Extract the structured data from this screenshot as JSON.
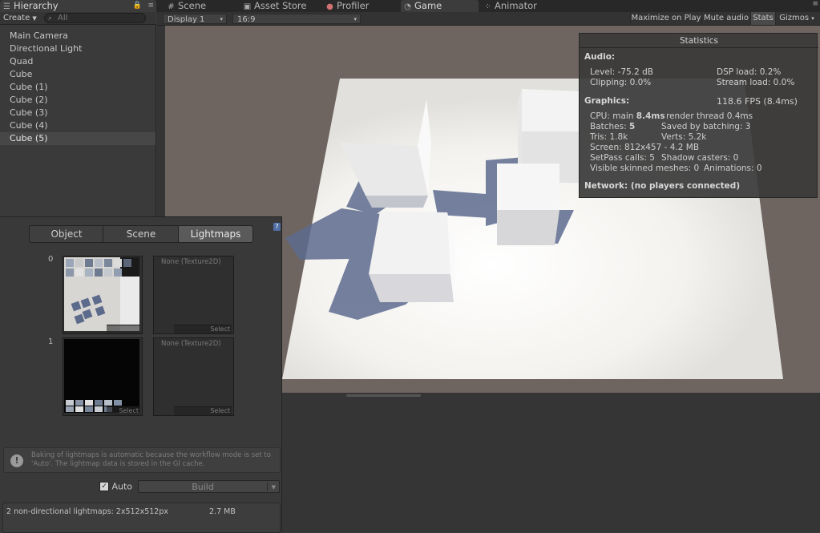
{
  "tabs": {
    "hierarchy": "Hierarchy",
    "scene": "Scene",
    "asset_store": "Asset Store",
    "profiler": "Profiler",
    "game": "Game",
    "animator": "Animator"
  },
  "hierarchy": {
    "create_label": "Create",
    "search_placeholder": "All",
    "items": [
      {
        "label": "Main Camera"
      },
      {
        "label": "Directional Light"
      },
      {
        "label": "Quad"
      },
      {
        "label": "Cube"
      },
      {
        "label": "Cube (1)"
      },
      {
        "label": "Cube (2)"
      },
      {
        "label": "Cube (3)"
      },
      {
        "label": "Cube (4)"
      },
      {
        "label": "Cube (5)"
      }
    ],
    "selected_index": 8
  },
  "game_toolbar": {
    "display": "Display 1",
    "aspect": "16:9",
    "maximize": "Maximize on Play",
    "mute": "Mute audio",
    "stats": "Stats",
    "gizmos": "Gizmos"
  },
  "lighting": {
    "tabs": [
      "Object",
      "Scene",
      "Lightmaps"
    ],
    "active_tab": "Lightmaps",
    "lightmaps": [
      {
        "index": "0",
        "none_label": "None (Texture2D)",
        "select": "Select"
      },
      {
        "index": "1",
        "none_label": "None (Texture2D)",
        "select": "Select"
      }
    ],
    "info": "Baking of lightmaps is automatic because the workflow mode is set to 'Auto'. The lightmap data is stored in the GI cache.",
    "auto_label": "Auto",
    "build_label": "Build",
    "summary": "2 non-directional lightmaps: 2x512x512px",
    "size": "2.7 MB"
  },
  "stats": {
    "title": "Statistics",
    "audio_header": "Audio:",
    "level": "Level: -75.2 dB",
    "dsp": "DSP load: 0.2%",
    "clipping": "Clipping: 0.0%",
    "stream": "Stream load: 0.0%",
    "graphics_header": "Graphics:",
    "fps": "118.6 FPS (8.4ms)",
    "cpu_prefix": "CPU: main ",
    "cpu_main": "8.4ms",
    "render_thread": "render thread 0.4ms",
    "batches_prefix": "Batches: ",
    "batches": "5",
    "saved": "Saved by batching: 3",
    "tris": "Tris: 1.8k",
    "verts": "Verts: 5.2k",
    "screen": "Screen: 812x457 - 4.2 MB",
    "setpass": "SetPass calls: 5",
    "shadow": "Shadow casters: 0",
    "skinned": "Visible skinned meshes: 0",
    "animations": "Animations: 0",
    "network": "Network: (no players connected)"
  }
}
